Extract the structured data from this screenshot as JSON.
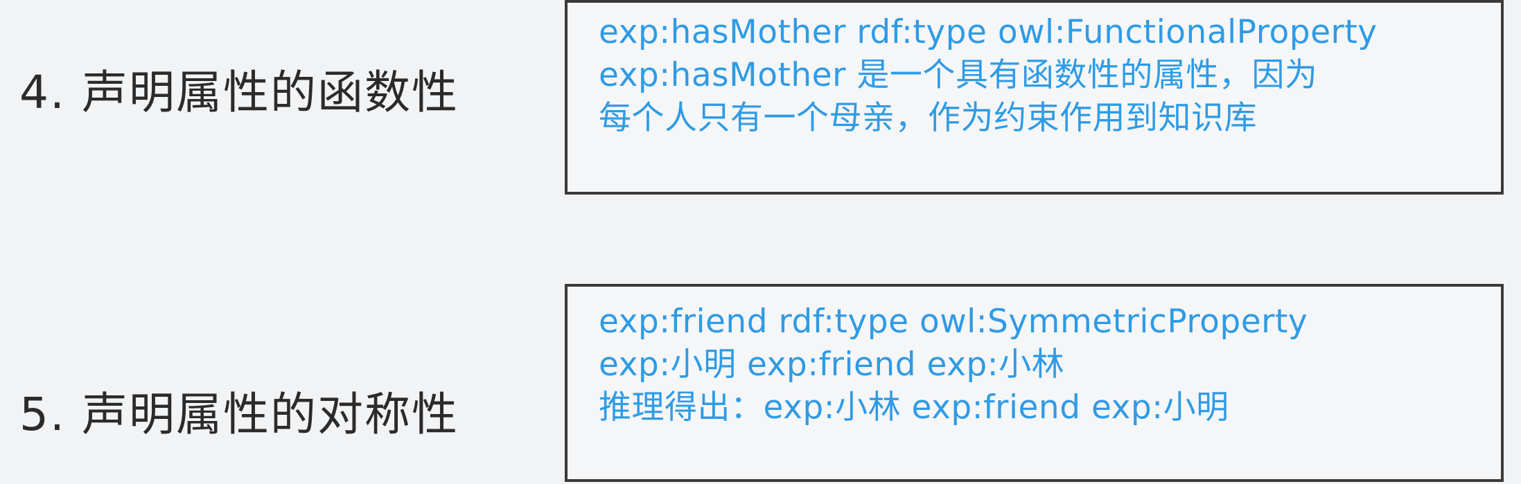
{
  "items": [
    {
      "heading": "4. 声明属性的函数性",
      "lines": [
        "exp:hasMother rdf:type owl:FunctionalProperty",
        "exp:hasMother 是一个具有函数性的属性，因为",
        "每个人只有一个母亲，作为约束作用到知识库"
      ]
    },
    {
      "heading": "5. 声明属性的对称性",
      "lines": [
        "exp:friend rdf:type owl:SymmetricProperty",
        "exp:小明 exp:friend exp:小林",
        "推理得出：exp:小林 exp:friend exp:小明"
      ]
    }
  ],
  "colors": {
    "heading_text": "#2b2b2b",
    "code_text": "#2f9be5",
    "box_border": "#3a3a3a",
    "background": "#f1f3f5"
  }
}
